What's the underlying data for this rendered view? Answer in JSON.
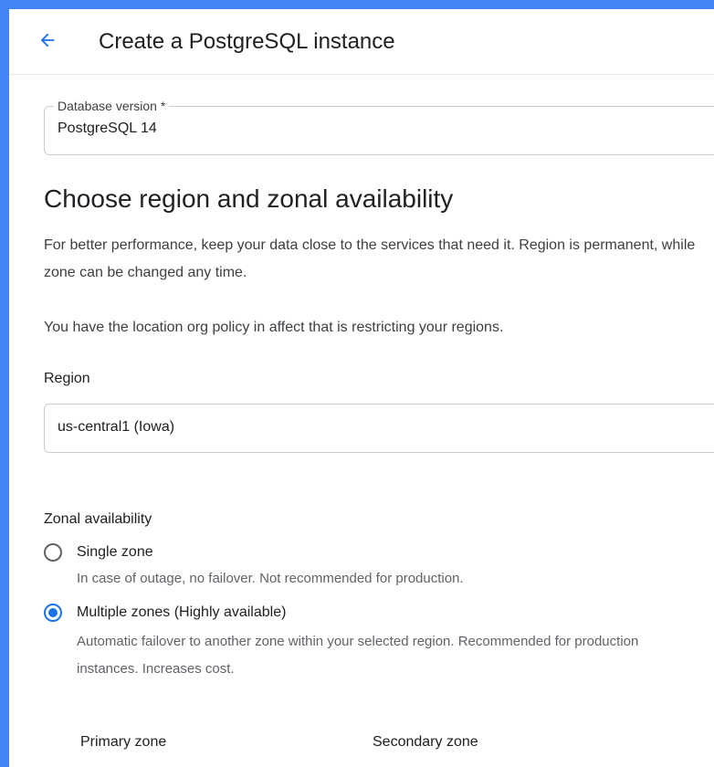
{
  "header": {
    "title": "Create a PostgreSQL instance",
    "back_icon": "arrow-back-icon",
    "accent_color": "#1a73e8"
  },
  "database_version": {
    "label": "Database version *",
    "value": "PostgreSQL 14"
  },
  "region_section": {
    "title": "Choose region and zonal availability",
    "description": "For better performance, keep your data close to the services that need it. Region is permanent, while zone can be changed any time.",
    "policy_note": "You have the location org policy in affect that is restricting your regions.",
    "region_label": "Region",
    "region_value": "us-central1 (Iowa)"
  },
  "zonal_availability": {
    "label": "Zonal availability",
    "options": [
      {
        "label": "Single zone",
        "description": "In case of outage, no failover. Not recommended for production.",
        "selected": false
      },
      {
        "label": "Multiple zones (Highly available)",
        "description": "Automatic failover to another zone within your selected region. Recommended for production instances. Increases cost.",
        "selected": true
      }
    ],
    "primary_zone_label": "Primary zone",
    "secondary_zone_label": "Secondary zone"
  }
}
